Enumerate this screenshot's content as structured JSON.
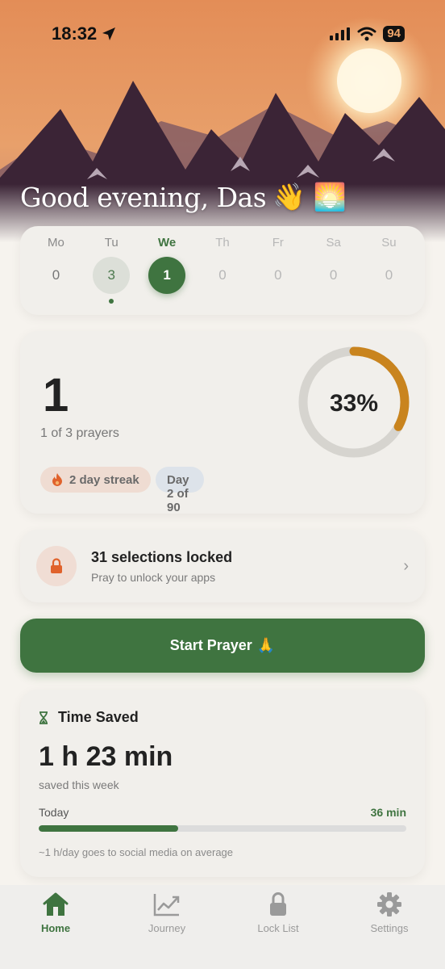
{
  "status_bar": {
    "time": "18:32",
    "battery": "94"
  },
  "greeting": {
    "text": "Good evening, Das",
    "emoji": "👋 🌅"
  },
  "week": {
    "days": [
      {
        "label": "Mo",
        "value": "0",
        "state": "past"
      },
      {
        "label": "Tu",
        "value": "3",
        "state": "past-done"
      },
      {
        "label": "We",
        "value": "1",
        "state": "today"
      },
      {
        "label": "Th",
        "value": "0",
        "state": "future"
      },
      {
        "label": "Fr",
        "value": "0",
        "state": "future"
      },
      {
        "label": "Sa",
        "value": "0",
        "state": "future"
      },
      {
        "label": "Su",
        "value": "0",
        "state": "future"
      }
    ]
  },
  "progress": {
    "count": "1",
    "prayers_text": "1 of 3 prayers",
    "percent_label": "33%",
    "percent_fraction": 0.33,
    "streak_badge": "2 day streak",
    "day_badge": "Day 2 of 90"
  },
  "locked": {
    "title": "31 selections locked",
    "subtitle": "Pray to unlock your apps"
  },
  "start_button": {
    "label": "Start Prayer",
    "emoji": "🙏"
  },
  "time_saved": {
    "header": "Time Saved",
    "total": "1 h 23 min",
    "subtitle": "saved this week",
    "today_label": "Today",
    "today_value": "36 min",
    "today_fraction": 0.38,
    "note": "~1 h/day goes to social media on average"
  },
  "tabs": [
    {
      "label": "Home",
      "icon": "home-icon",
      "active": true
    },
    {
      "label": "Journey",
      "icon": "chart-icon",
      "active": false
    },
    {
      "label": "Lock List",
      "icon": "lock-icon",
      "active": false
    },
    {
      "label": "Settings",
      "icon": "gear-icon",
      "active": false
    }
  ],
  "colors": {
    "accent": "#3f7440",
    "ring": "#c9841e",
    "sky": "#e39a5f",
    "mountain": "#3b2436"
  }
}
